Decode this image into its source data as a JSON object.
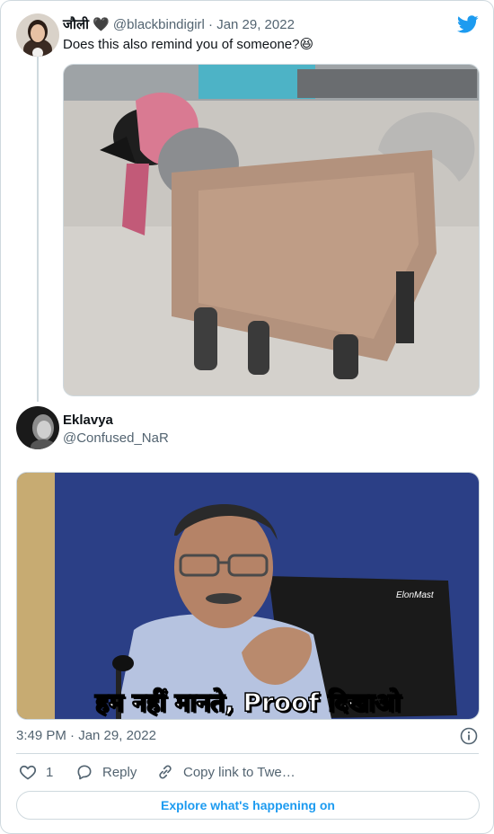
{
  "tweet1": {
    "display_name": "जौली 🖤",
    "handle_date": "@blackbindigirl · Jan 29, 2022",
    "text": "Does this also remind you of someone?😆"
  },
  "tweet2": {
    "display_name": "Eklavya",
    "handle": "@Confused_NaR",
    "meme_caption": "हम नहीं मानते, Proof दिखाओ",
    "watermark": "ElonMast"
  },
  "footer": {
    "timestamp": "3:49 PM · Jan 29, 2022",
    "like_count": "1",
    "reply_label": "Reply",
    "copy_link_label": "Copy link to Twe…",
    "explore_label": "Explore what's happening on"
  },
  "colors": {
    "brand_blue": "#1d9bf0",
    "text": "#0f1419",
    "muted": "#536471",
    "border": "#cfd9de"
  }
}
